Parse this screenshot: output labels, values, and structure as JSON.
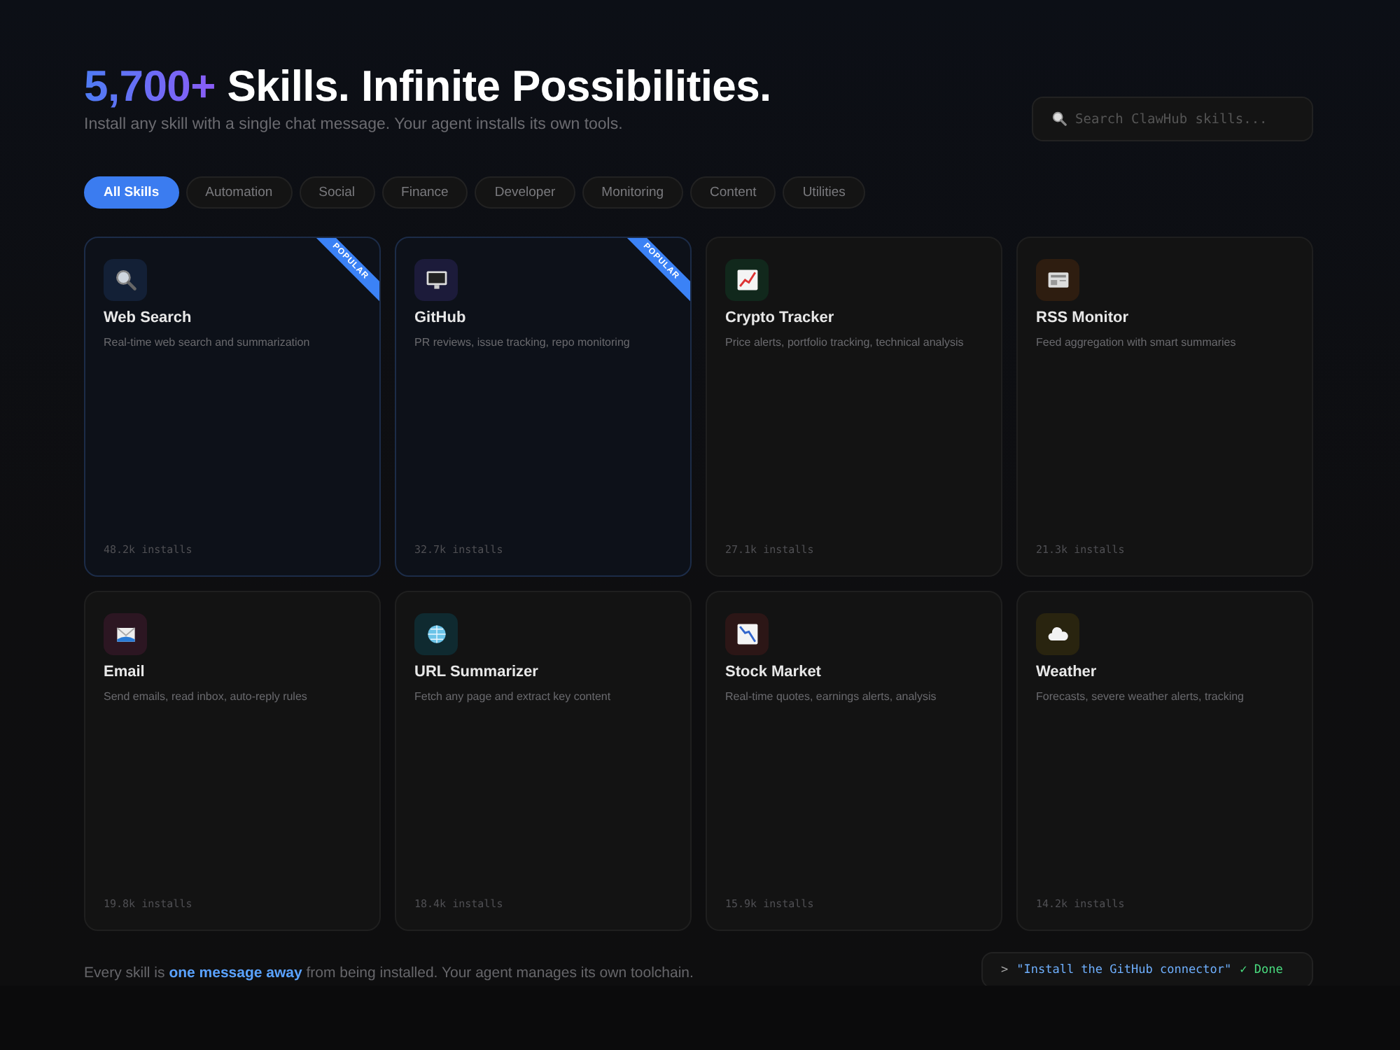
{
  "hero": {
    "count": "5,700+",
    "title": "Skills. Infinite Possibilities.",
    "subtitle": "Install any skill with a single chat message. Your agent installs its own tools."
  },
  "search": {
    "placeholder": "Search ClawHub skills..."
  },
  "tabs": [
    {
      "label": "All Skills",
      "selected": true
    },
    {
      "label": "Automation",
      "selected": false
    },
    {
      "label": "Social",
      "selected": false
    },
    {
      "label": "Finance",
      "selected": false
    },
    {
      "label": "Developer",
      "selected": false
    },
    {
      "label": "Monitoring",
      "selected": false
    },
    {
      "label": "Content",
      "selected": false
    },
    {
      "label": "Utilities",
      "selected": false
    }
  ],
  "skills": [
    {
      "kind": "search",
      "name": "Web Search",
      "description": "Real-time web search and summarization",
      "installs": "48.2k installs",
      "badge": "POPULAR"
    },
    {
      "kind": "monitor",
      "name": "GitHub",
      "description": "PR reviews, issue tracking, repo monitoring",
      "installs": "32.7k installs",
      "badge": "POPULAR"
    },
    {
      "kind": "chart-up",
      "name": "Crypto Tracker",
      "description": "Price alerts, portfolio tracking, technical analysis",
      "installs": "27.1k installs"
    },
    {
      "kind": "newspaper",
      "name": "RSS Monitor",
      "description": "Feed aggregation with smart summaries",
      "installs": "21.3k installs"
    },
    {
      "kind": "mail",
      "name": "Email",
      "description": "Send emails, read inbox, auto-reply rules",
      "installs": "19.8k installs"
    },
    {
      "kind": "globe",
      "name": "URL Summarizer",
      "description": "Fetch any page and extract key content",
      "installs": "18.4k installs"
    },
    {
      "kind": "chart-down",
      "name": "Stock Market",
      "description": "Real-time quotes, earnings alerts, analysis",
      "installs": "15.9k installs"
    },
    {
      "kind": "cloud",
      "name": "Weather",
      "description": "Forecasts, severe weather alerts, tracking",
      "installs": "14.2k installs"
    }
  ],
  "footer": {
    "text": "Every skill is **one message away** from being installed. Your agent manages its own toolchain.",
    "terminal": {
      "prompt": ">",
      "command": "\"Install the GitHub connector\"",
      "status": "✓ Done"
    }
  }
}
